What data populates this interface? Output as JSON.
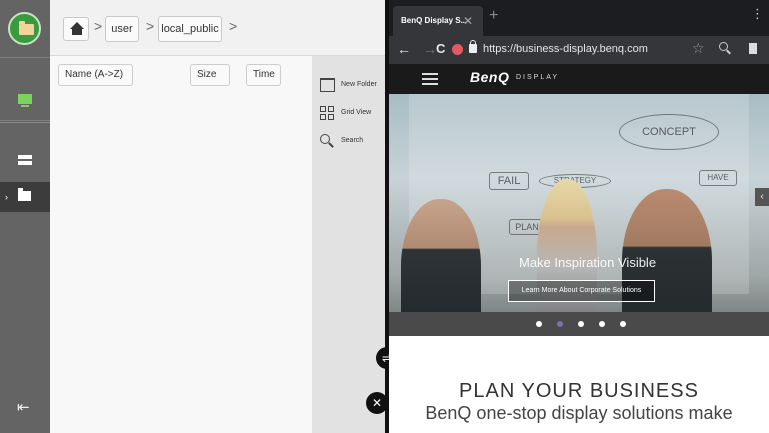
{
  "file_manager": {
    "breadcrumb": [
      "user",
      "local_public"
    ],
    "columns": {
      "name": "Name (A->Z)",
      "size": "Size",
      "time": "Time"
    },
    "tools": {
      "new_folder": "New Folder",
      "grid_view": "Grid View",
      "search": "Search"
    }
  },
  "browser": {
    "tab_title": "BenQ Display S...",
    "url": "https://business-display.benq.com",
    "brand": "BenQ",
    "brand_sub": "DISPLAY",
    "hero_tagline": "Make Inspiration Visible",
    "hero_cta": "Learn More About Corporate Solutions",
    "carousel_active_index": 1,
    "carousel_count": 5,
    "plan_title": "PLAN YOUR BUSINESS",
    "plan_subtitle": "BenQ one-stop display solutions make"
  },
  "doodles": [
    "CONCEPT",
    "FAIL",
    "STRATEGY",
    "PLAN",
    "HAVE"
  ],
  "colors": {
    "rail": "#646464",
    "accent_green": "#3a9a3f",
    "carousel_active": "#7b6fb6"
  }
}
